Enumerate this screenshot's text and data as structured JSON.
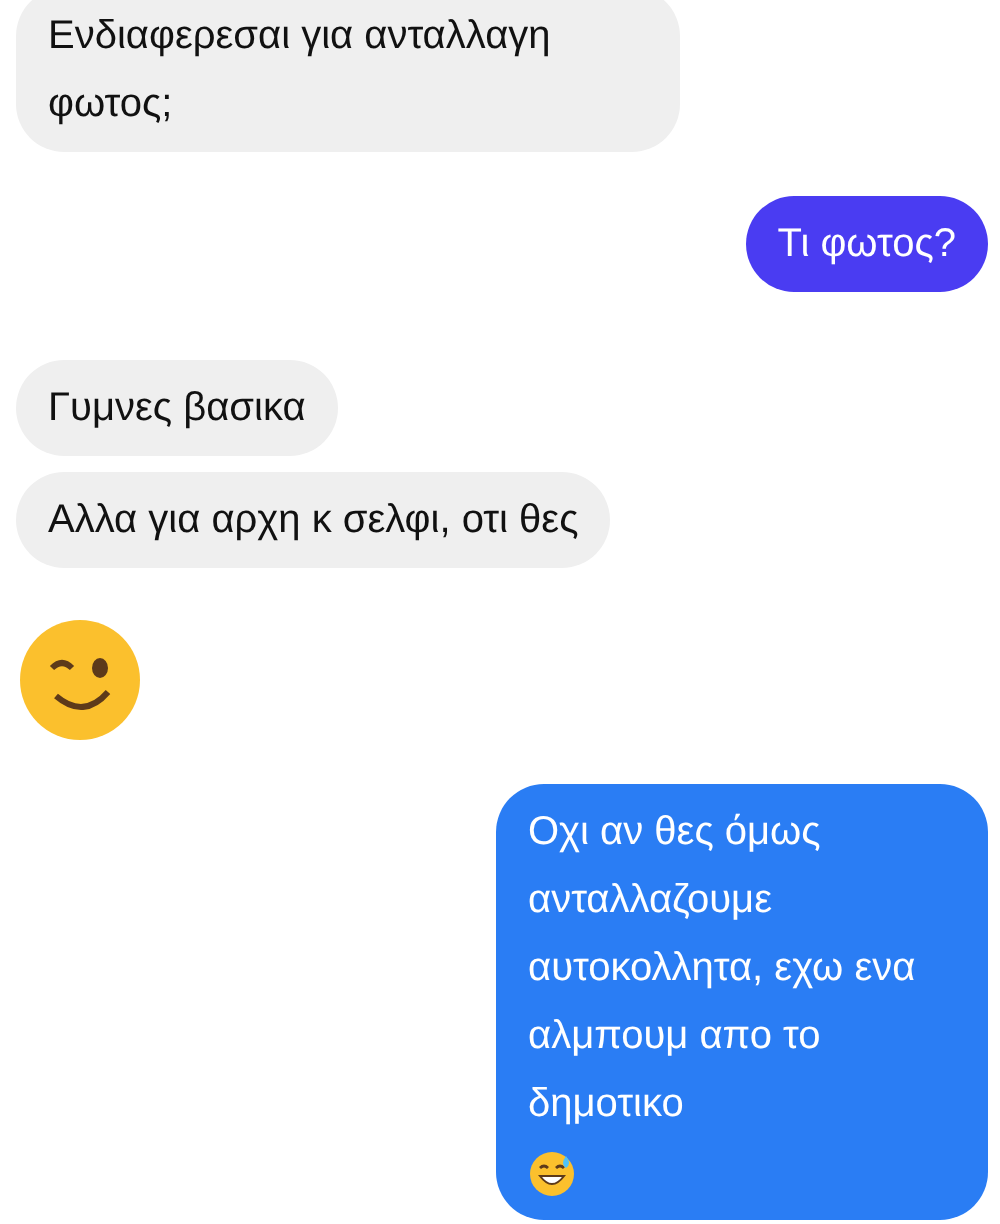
{
  "messages": [
    {
      "kind": "incoming",
      "text": "Ενδιαφερεσαι για ανταλλαγη φωτος;"
    },
    {
      "kind": "outgoing",
      "text": "Τι φωτος?",
      "color": "#4a3cf2"
    },
    {
      "kind": "incoming",
      "text": "Γυμνες βασικα"
    },
    {
      "kind": "incoming",
      "text": "Αλλα για αρχη κ σελφι, οτι θες"
    },
    {
      "kind": "emoji"
    },
    {
      "kind": "outgoing",
      "text": "Οχι αν θες όμως ανταλλαζουμε αυτοκολλητα, εχω ενα αλμπουμ απο το δημοτικο",
      "color": "#2a7df4",
      "trailing_emoji": true
    }
  ]
}
